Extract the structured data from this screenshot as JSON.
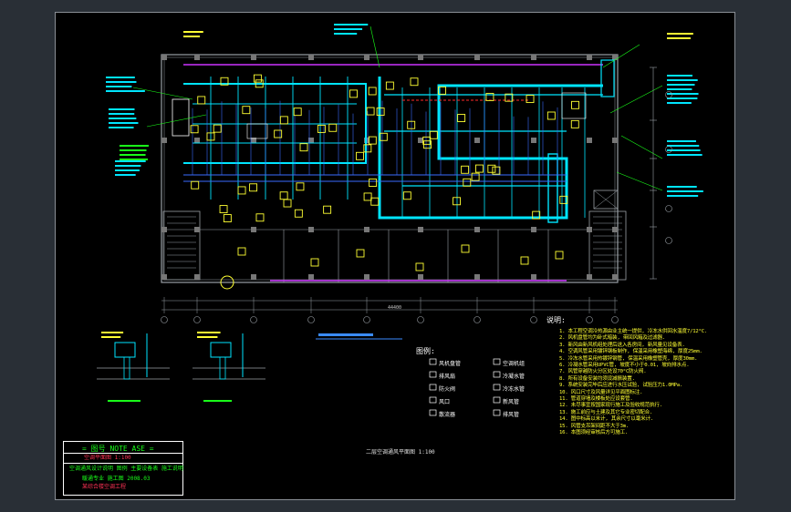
{
  "legend": {
    "title": "图例:",
    "items": [
      "风机盘管",
      "排风扇",
      "防火阀",
      "风口",
      "散流器",
      "空调机组",
      "冷凝水管",
      "冷冻水管",
      "新风管",
      "排风管"
    ]
  },
  "notes": {
    "title": "说明:",
    "lines": [
      "1. 本工程空调冷热源由业主统一提供, 冷冻水供回水温度7/12°C.",
      "2. 风机盘管均为卧式暗装, 带回风箱及过滤器.",
      "3. 新风由新风机组处理后送入各房间, 新风量见设备表.",
      "4. 空调风管采用镀锌钢板制作, 保温采用橡塑海绵, 厚度25mm.",
      "5. 冷冻水管采用热镀锌钢管, 保温采用橡塑管壳, 厚度30mm.",
      "6. 冷凝水管采用UPVC管, 坡度不小于0.01, 坡向排水点.",
      "7. 风管穿越防火分区处设70°C防火阀.",
      "8. 所有设备安装均须设减振装置.",
      "9. 系统安装完毕后应进行水压试验, 试验压力1.0MPa.",
      "10. 风口尺寸及风量详见平面图标注.",
      "11. 管道穿墙及楼板处应设套管.",
      "12. 未尽事宜按国家现行施工及验收规范执行.",
      "13. 施工前应与土建及其它专业密切配合.",
      "14. 图中标高以米计, 其余尺寸以毫米计.",
      "15. 风管支吊架间距不大于3m.",
      "16. 本图须经审核后方可施工."
    ]
  },
  "title_block": {
    "release": "= 图号  NOTE ASE =",
    "project": "空调平面图  1:100",
    "line1": "空调通风设计说明 图例 主要设备表 施工说明",
    "line2": "暖通专业 施工图 2008.03",
    "line3": "某综合楼空调工程"
  },
  "drawing_title": "二层空调通风平面图 1:100",
  "total_dimension": "44400",
  "colors": {
    "background": "#292f36",
    "sheet": "#000000",
    "duct": "#00e5ff",
    "wall": "#9aa0a6",
    "fan_coil": "#ffff33",
    "pipe_supply": "#3a6bff",
    "fresh_air": "#cc33ff",
    "leader": "#19ff19"
  }
}
